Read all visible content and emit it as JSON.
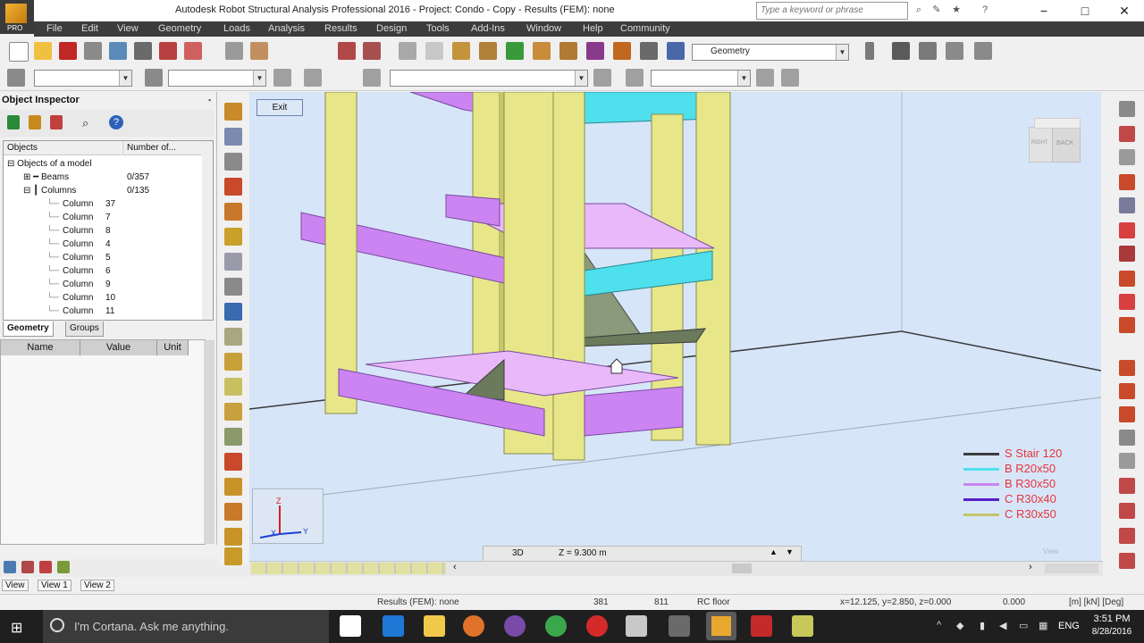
{
  "window": {
    "title": "Autodesk Robot Structural Analysis Professional 2016 - Project: Condo - Copy - Results (FEM): none",
    "app_badge": "PRO",
    "search_placeholder": "Type a keyword or phrase",
    "minimize": "−",
    "maximize": "□",
    "close": "✕"
  },
  "menu": [
    "File",
    "Edit",
    "View",
    "Geometry",
    "Loads",
    "Analysis",
    "Results",
    "Design",
    "Tools",
    "Add-Ins",
    "Window",
    "Help",
    "Community"
  ],
  "toolbar": {
    "layout_selector": "Geometry"
  },
  "inspector": {
    "title": "Object Inspector",
    "columns": [
      "Objects",
      "Number of..."
    ],
    "root": "Objects of a model",
    "groups": [
      {
        "label": "Beams",
        "count": "0/357"
      },
      {
        "label": "Columns",
        "count": "0/135"
      }
    ],
    "columns_children": [
      {
        "label": "Column",
        "num": "37"
      },
      {
        "label": "Column",
        "num": "7"
      },
      {
        "label": "Column",
        "num": "8"
      },
      {
        "label": "Column",
        "num": "4"
      },
      {
        "label": "Column",
        "num": "5"
      },
      {
        "label": "Column",
        "num": "6"
      },
      {
        "label": "Column",
        "num": "9"
      },
      {
        "label": "Column",
        "num": "10"
      },
      {
        "label": "Column",
        "num": "11"
      }
    ],
    "tabs": [
      "Geometry",
      "Groups"
    ],
    "props_headers": [
      "Name",
      "Value",
      "Unit"
    ]
  },
  "viewport": {
    "exit_label": "Exit",
    "view_cube": {
      "right": "RIGHT",
      "back": "BACK"
    },
    "axes": {
      "z": "Z",
      "x": "X",
      "y": "Y"
    },
    "mode": "3D",
    "z_level": "Z = 9.300 m",
    "view_corner": "View"
  },
  "legend": [
    {
      "label": "S Stair 120",
      "color": "#3d3d3d"
    },
    {
      "label": "B R20x50",
      "color": "#4ee0ec"
    },
    {
      "label": "B R30x50",
      "color": "#cc84f2"
    },
    {
      "label": "C R30x40",
      "color": "#5820c8"
    },
    {
      "label": "C R30x50",
      "color": "#c4c46a"
    }
  ],
  "view_tabs": [
    "View",
    "View 1",
    "View 2"
  ],
  "status": {
    "results": "Results (FEM): none",
    "num1": "381",
    "num2": "811",
    "section": "RC floor",
    "coords": "x=12.125, y=2.850, z=0.000",
    "angle": "0.000",
    "units": "[m] [kN] [Deg]"
  },
  "taskbar": {
    "search": "I'm Cortana. Ask me anything.",
    "lang": "ENG",
    "time": "3:51 PM",
    "date": "8/28/2016"
  }
}
